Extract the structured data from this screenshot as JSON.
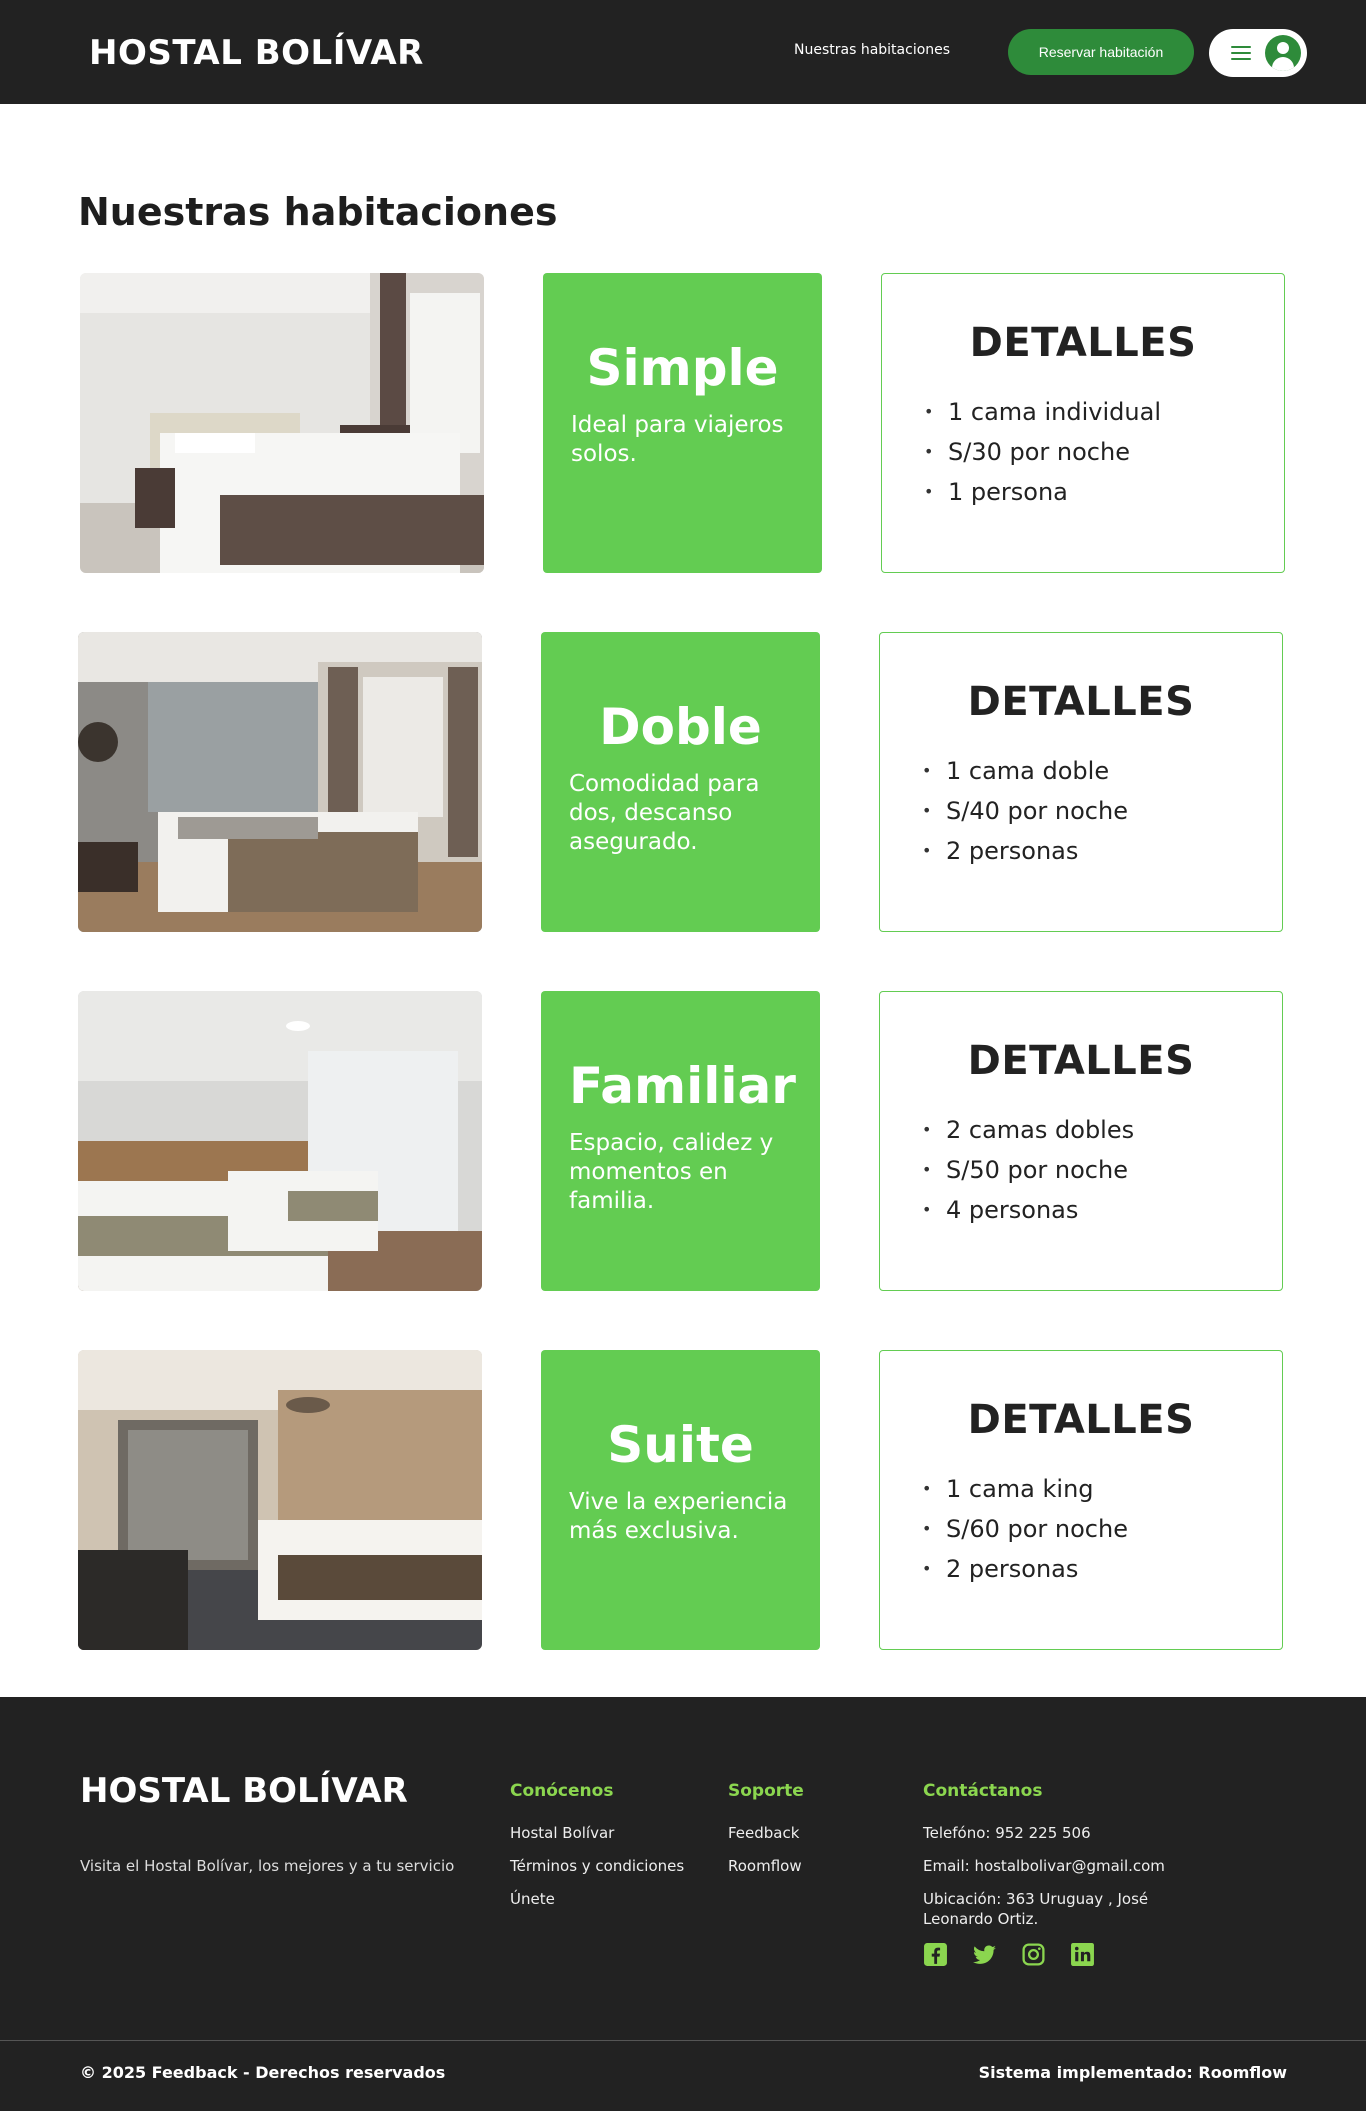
{
  "header": {
    "brand": "HOSTAL BOLÍVAR",
    "nav_link": "Nuestras habitaciones",
    "reserve_button": "Reservar habitación"
  },
  "main": {
    "title": "Nuestras habitaciones",
    "rooms": [
      {
        "name": "Simple",
        "description": "Ideal para viajeros solos.",
        "details_title": "DETALLES",
        "details": [
          "1 cama individual",
          "S/30 por noche",
          "1 persona"
        ]
      },
      {
        "name": "Doble",
        "description": "Comodidad para dos, descanso asegurado.",
        "details_title": "DETALLES",
        "details": [
          "1 cama doble",
          "S/40 por noche",
          "2 personas"
        ]
      },
      {
        "name": "Familiar",
        "description": "Espacio, calidez y momentos en familia.",
        "details_title": "DETALLES",
        "details": [
          "2 camas dobles",
          "S/50 por noche",
          "4 personas"
        ]
      },
      {
        "name": "Suite",
        "description": "Vive la experiencia más exclusiva.",
        "details_title": "DETALLES",
        "details": [
          "1 cama king",
          "S/60 por noche",
          "2 personas"
        ]
      }
    ]
  },
  "footer": {
    "brand": "HOSTAL BOLÍVAR",
    "tagline": "Visita el Hostal Bolívar, los mejores y a tu servicio",
    "know": {
      "heading": "Conócenos",
      "links": [
        "Hostal Bolívar",
        "Términos y condiciones",
        "Únete"
      ]
    },
    "support": {
      "heading": "Soporte",
      "links": [
        "Feedback",
        "Roomflow"
      ]
    },
    "contact": {
      "heading": "Contáctanos",
      "phone": "Telefóno: 952 225 506",
      "email": "Email: hostalbolivar@gmail.com",
      "location": "Ubicación: 363 Uruguay , José Leonardo Ortiz."
    },
    "social_icons": [
      "facebook-icon",
      "twitter-icon",
      "instagram-icon",
      "linkedin-icon"
    ],
    "copyright": "© 2025 Feedback - Derechos reservados",
    "system": "Sistema implementado: Roomflow"
  },
  "colors": {
    "header_bg": "#222222",
    "accent_green": "#63cc52",
    "button_green": "#2e8b3a",
    "footer_heading": "#8bd64f"
  }
}
